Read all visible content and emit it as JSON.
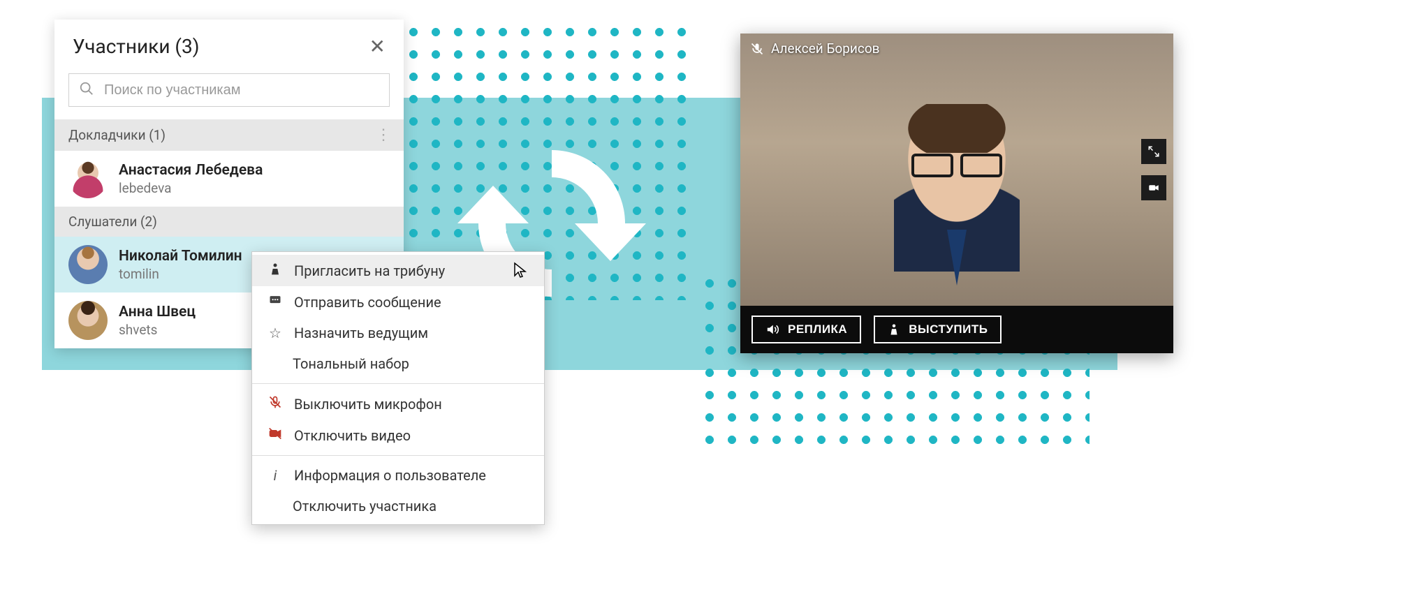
{
  "participants_panel": {
    "title": "Участники (3)",
    "search_placeholder": "Поиск по участникам",
    "sections": {
      "speakers": {
        "header": "Докладчики (1)"
      },
      "listeners": {
        "header": "Слушатели (2)"
      }
    },
    "members": {
      "speaker1": {
        "name": "Анастасия Лебедева",
        "login": "lebedeva"
      },
      "listener1": {
        "name": "Николай Томилин",
        "login": "tomilin"
      },
      "listener2": {
        "name": "Анна Швец",
        "login": "shvets"
      }
    }
  },
  "context_menu": {
    "invite_podium": "Пригласить на трибуну",
    "send_message": "Отправить сообщение",
    "make_moderator": "Назначить ведущим",
    "dtmf": "Тональный набор",
    "mute_mic": "Выключить микрофон",
    "disable_video": "Отключить видео",
    "user_info": "Информация о пользователе",
    "disconnect": "Отключить участника"
  },
  "video_panel": {
    "participant_name": "Алексей Борисов",
    "button_reply": "РЕПЛИКА",
    "button_speak": "ВЫСТУПИТЬ"
  }
}
